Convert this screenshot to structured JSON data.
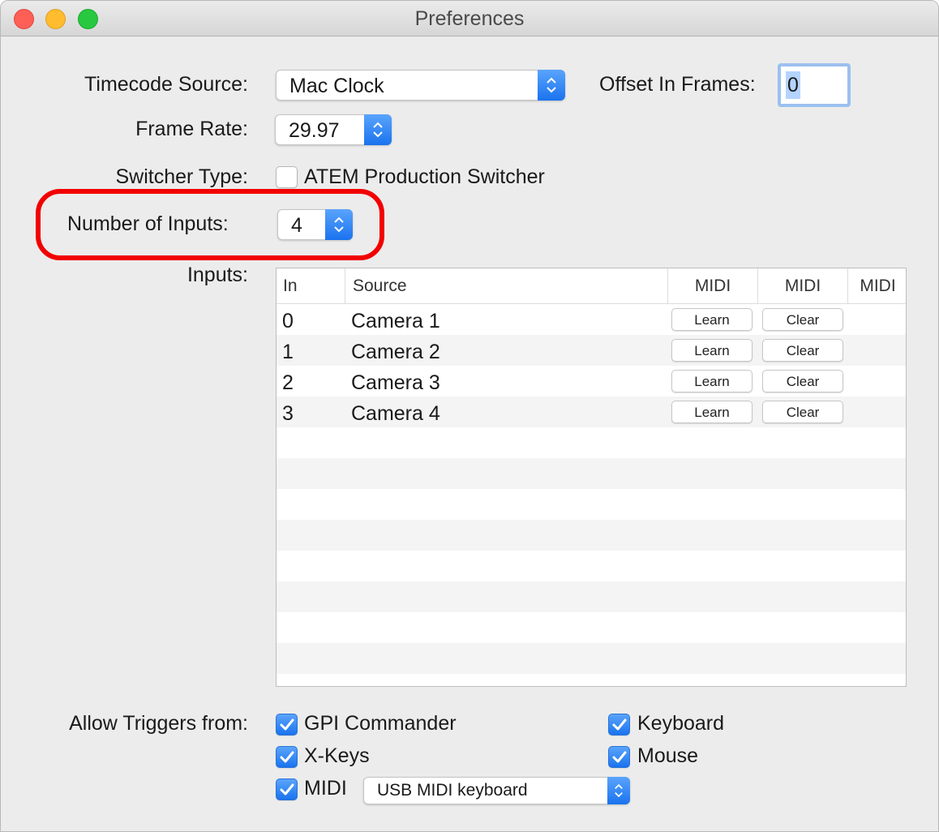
{
  "window": {
    "title": "Preferences"
  },
  "timecode": {
    "label": "Timecode Source:",
    "value": "Mac Clock"
  },
  "offset": {
    "label": "Offset In Frames:",
    "value": "0"
  },
  "frame_rate": {
    "label": "Frame Rate:",
    "value": "29.97"
  },
  "switcher": {
    "label": "Switcher Type:",
    "checkbox_label": "ATEM Production Switcher",
    "checked": false
  },
  "num_inputs": {
    "label": "Number of Inputs:",
    "value": "4"
  },
  "inputs": {
    "label": "Inputs:",
    "columns": [
      "In",
      "Source",
      "MIDI",
      "MIDI",
      "MIDI"
    ],
    "rows": [
      {
        "in": "0",
        "source": "Camera 1",
        "learn": "Learn",
        "clear": "Clear"
      },
      {
        "in": "1",
        "source": "Camera 2",
        "learn": "Learn",
        "clear": "Clear"
      },
      {
        "in": "2",
        "source": "Camera 3",
        "learn": "Learn",
        "clear": "Clear"
      },
      {
        "in": "3",
        "source": "Camera 4",
        "learn": "Learn",
        "clear": "Clear"
      }
    ]
  },
  "triggers": {
    "label": "Allow Triggers from:",
    "gpi": {
      "label": "GPI Commander",
      "checked": true
    },
    "keyboard": {
      "label": "Keyboard",
      "checked": true
    },
    "xkeys": {
      "label": "X-Keys",
      "checked": true
    },
    "mouse": {
      "label": "Mouse",
      "checked": true
    },
    "midi": {
      "label": "MIDI",
      "checked": true,
      "device": "USB MIDI keyboard"
    }
  },
  "colors": {
    "accent": "#1a73ee",
    "highlight": "#f20000"
  }
}
